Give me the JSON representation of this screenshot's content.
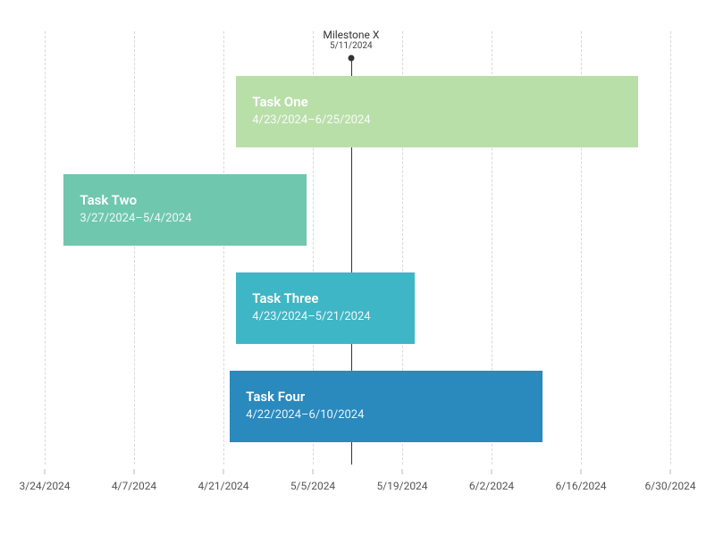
{
  "chart_data": {
    "type": "gantt",
    "x_axis": {
      "start": "3/24/2024",
      "end": "6/30/2024",
      "ticks": [
        "3/24/2024",
        "4/7/2024",
        "4/21/2024",
        "5/5/2024",
        "5/19/2024",
        "6/2/2024",
        "6/16/2024",
        "6/30/2024"
      ]
    },
    "milestone": {
      "name": "Milestone X",
      "date": "5/11/2024"
    },
    "tasks": [
      {
        "name": "Task One",
        "start": "4/23/2024",
        "end": "6/25/2024",
        "color": "#b9dfa9"
      },
      {
        "name": "Task Two",
        "start": "3/27/2024",
        "end": "5/4/2024",
        "color": "#6fc7ae"
      },
      {
        "name": "Task Three",
        "start": "4/23/2024",
        "end": "5/21/2024",
        "color": "#3fb6c6"
      },
      {
        "name": "Task Four",
        "start": "4/22/2024",
        "end": "6/10/2024",
        "color": "#2a89bd"
      }
    ]
  }
}
